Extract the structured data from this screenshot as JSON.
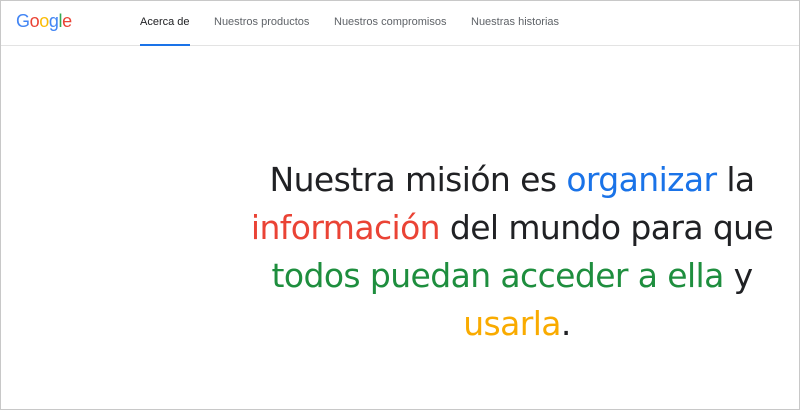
{
  "logo": {
    "letters": [
      {
        "char": "G",
        "color": "#4285f4"
      },
      {
        "char": "o",
        "color": "#ea4335"
      },
      {
        "char": "o",
        "color": "#fbbc05"
      },
      {
        "char": "g",
        "color": "#4285f4"
      },
      {
        "char": "l",
        "color": "#34a853"
      },
      {
        "char": "e",
        "color": "#ea4335"
      }
    ]
  },
  "nav": {
    "tabs": [
      {
        "label": "Acerca de",
        "active": true
      },
      {
        "label": "Nuestros productos",
        "active": false
      },
      {
        "label": "Nuestros compromisos",
        "active": false
      },
      {
        "label": "Nuestras historias",
        "active": false
      }
    ],
    "active_indicator_color": "#1a73e8"
  },
  "mission": {
    "segments": [
      {
        "text": "Nuestra misión es ",
        "color": "#202124"
      },
      {
        "text": "organizar",
        "color": "#1a73e8"
      },
      {
        "text": " la ",
        "color": "#202124"
      },
      {
        "text": "información",
        "color": "#ea4335"
      },
      {
        "text": " del mundo para que ",
        "color": "#202124"
      },
      {
        "text": "todos puedan acceder a ella",
        "color": "#1e8e3e"
      },
      {
        "text": " y ",
        "color": "#202124"
      },
      {
        "text": "usarla",
        "color": "#f9ab00"
      },
      {
        "text": ".",
        "color": "#202124"
      }
    ]
  }
}
